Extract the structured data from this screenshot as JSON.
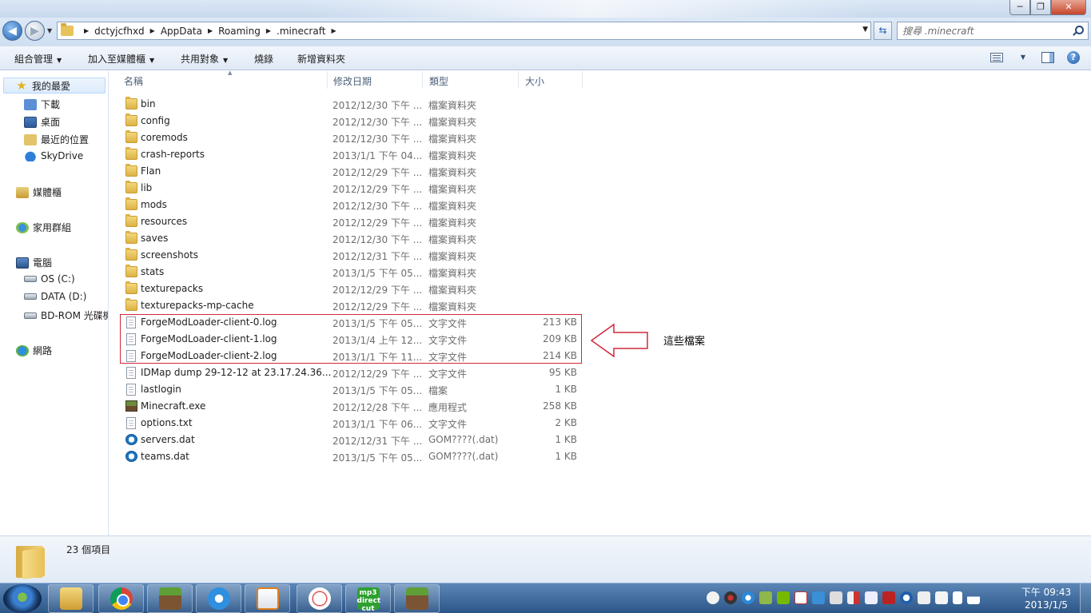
{
  "window": {
    "buttons": {
      "minimize": "─",
      "maximize": "❐",
      "close": "✕"
    }
  },
  "address": {
    "crumbs": [
      "dctyjcfhxd",
      "AppData",
      "Roaming",
      ".minecraft"
    ],
    "search_placeholder": "搜尋 .minecraft"
  },
  "toolbar": {
    "organize": "組合管理",
    "add_library": "加入至媒體櫃",
    "share": "共用對象",
    "burn": "燒錄",
    "new_folder": "新增資料夾"
  },
  "nav": {
    "favorites": "我的最愛",
    "downloads": "下載",
    "desktop": "桌面",
    "recent": "最近的位置",
    "skydrive": "SkyDrive",
    "libraries": "媒體櫃",
    "homegroup": "家用群組",
    "computer": "電腦",
    "drive_c": "OS (C:)",
    "drive_d": "DATA (D:)",
    "drive_bd": "BD-ROM 光碟機",
    "network": "網路"
  },
  "columns": {
    "name": "名稱",
    "date": "修改日期",
    "type": "類型",
    "size": "大小"
  },
  "files": [
    {
      "name": "bin",
      "date": "2012/12/30 下午 ...",
      "type": "檔案資料夾",
      "size": "",
      "icon": "folder-icon"
    },
    {
      "name": "config",
      "date": "2012/12/30 下午 ...",
      "type": "檔案資料夾",
      "size": "",
      "icon": "folder-icon"
    },
    {
      "name": "coremods",
      "date": "2012/12/30 下午 ...",
      "type": "檔案資料夾",
      "size": "",
      "icon": "folder-icon"
    },
    {
      "name": "crash-reports",
      "date": "2013/1/1 下午 04...",
      "type": "檔案資料夾",
      "size": "",
      "icon": "folder-icon"
    },
    {
      "name": "Flan",
      "date": "2012/12/29 下午 ...",
      "type": "檔案資料夾",
      "size": "",
      "icon": "folder-icon"
    },
    {
      "name": "lib",
      "date": "2012/12/29 下午 ...",
      "type": "檔案資料夾",
      "size": "",
      "icon": "folder-icon"
    },
    {
      "name": "mods",
      "date": "2012/12/30 下午 ...",
      "type": "檔案資料夾",
      "size": "",
      "icon": "folder-icon"
    },
    {
      "name": "resources",
      "date": "2012/12/29 下午 ...",
      "type": "檔案資料夾",
      "size": "",
      "icon": "folder-icon"
    },
    {
      "name": "saves",
      "date": "2012/12/30 下午 ...",
      "type": "檔案資料夾",
      "size": "",
      "icon": "folder-icon"
    },
    {
      "name": "screenshots",
      "date": "2012/12/31 下午 ...",
      "type": "檔案資料夾",
      "size": "",
      "icon": "folder-icon"
    },
    {
      "name": "stats",
      "date": "2013/1/5 下午 05...",
      "type": "檔案資料夾",
      "size": "",
      "icon": "folder-icon"
    },
    {
      "name": "texturepacks",
      "date": "2012/12/29 下午 ...",
      "type": "檔案資料夾",
      "size": "",
      "icon": "folder-icon"
    },
    {
      "name": "texturepacks-mp-cache",
      "date": "2012/12/29 下午 ...",
      "type": "檔案資料夾",
      "size": "",
      "icon": "folder-icon"
    },
    {
      "name": "ForgeModLoader-client-0.log",
      "date": "2013/1/5 下午 05...",
      "type": "文字文件",
      "size": "213 KB",
      "icon": "text-file-icon"
    },
    {
      "name": "ForgeModLoader-client-1.log",
      "date": "2013/1/4 上午 12...",
      "type": "文字文件",
      "size": "209 KB",
      "icon": "text-file-icon"
    },
    {
      "name": "ForgeModLoader-client-2.log",
      "date": "2013/1/1 下午 11...",
      "type": "文字文件",
      "size": "214 KB",
      "icon": "text-file-icon"
    },
    {
      "name": "IDMap dump 29-12-12 at 23.17.24.36...",
      "date": "2012/12/29 下午 ...",
      "type": "文字文件",
      "size": "95 KB",
      "icon": "text-file-icon"
    },
    {
      "name": "lastlogin",
      "date": "2013/1/5 下午 05...",
      "type": "檔案",
      "size": "1 KB",
      "icon": "file-icon"
    },
    {
      "name": "Minecraft.exe",
      "date": "2012/12/28 下午 ...",
      "type": "應用程式",
      "size": "258 KB",
      "icon": "minecraft-exe-icon"
    },
    {
      "name": "options.txt",
      "date": "2013/1/1 下午 06...",
      "type": "文字文件",
      "size": "2 KB",
      "icon": "text-file-icon"
    },
    {
      "name": "servers.dat",
      "date": "2012/12/31 下午 ...",
      "type": "GOM????(.dat)",
      "size": "1 KB",
      "icon": "dat-file-icon"
    },
    {
      "name": "teams.dat",
      "date": "2013/1/5 下午 05...",
      "type": "GOM????(.dat)",
      "size": "1 KB",
      "icon": "dat-file-icon"
    }
  ],
  "annotation": {
    "text": "這些檔案",
    "color": "#d0293a"
  },
  "status": {
    "count": "23 個項目"
  },
  "taskbar": {
    "apps": [
      "windows-explorer-icon",
      "chrome-icon",
      "minecraft-icon",
      "internet-explorer-icon",
      "media-player-icon",
      "snipping-tool-icon",
      "mp3-direct-cut-icon",
      "minecraft-icon"
    ],
    "mp3_label": "mp3 direct cut",
    "clock_time": "下午 09:43",
    "clock_date": "2013/1/5"
  },
  "colors": {
    "accent": "#3a7fd0",
    "highlight_box": "#d0293a",
    "taskbar": "#2c5688"
  }
}
